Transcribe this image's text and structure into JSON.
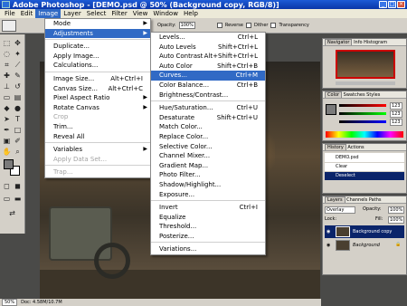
{
  "window": {
    "title": "Adobe Photoshop - [DEMO.psd @ 50% (Background copy, RGB/8)]",
    "controls": [
      "_",
      "□",
      "×"
    ]
  },
  "menubar": [
    "File",
    "Edit",
    "Image",
    "Layer",
    "Select",
    "Filter",
    "View",
    "Window",
    "Help"
  ],
  "options": {
    "opacity_label": "Opacity:",
    "opacity_value": "100%",
    "reverse": "Reverse",
    "dither": "Dither",
    "transparency": "Transparency"
  },
  "image_menu": [
    {
      "label": "Mode",
      "arrow": true
    },
    {
      "label": "Adjustments",
      "arrow": true,
      "selected": true
    },
    {
      "sep": true
    },
    {
      "label": "Duplicate..."
    },
    {
      "label": "Apply Image..."
    },
    {
      "label": "Calculations..."
    },
    {
      "sep": true
    },
    {
      "label": "Image Size...",
      "shortcut": "Alt+Ctrl+I"
    },
    {
      "label": "Canvas Size...",
      "shortcut": "Alt+Ctrl+C"
    },
    {
      "label": "Pixel Aspect Ratio",
      "arrow": true
    },
    {
      "label": "Rotate Canvas",
      "arrow": true
    },
    {
      "label": "Crop",
      "disabled": true
    },
    {
      "label": "Trim..."
    },
    {
      "label": "Reveal All"
    },
    {
      "sep": true
    },
    {
      "label": "Variables",
      "arrow": true
    },
    {
      "label": "Apply Data Set...",
      "disabled": true
    },
    {
      "sep": true
    },
    {
      "label": "Trap...",
      "disabled": true
    }
  ],
  "adjustments_menu": [
    {
      "label": "Levels...",
      "shortcut": "Ctrl+L"
    },
    {
      "label": "Auto Levels",
      "shortcut": "Shift+Ctrl+L"
    },
    {
      "label": "Auto Contrast",
      "shortcut": "Alt+Shift+Ctrl+L"
    },
    {
      "label": "Auto Color",
      "shortcut": "Shift+Ctrl+B"
    },
    {
      "label": "Curves...",
      "shortcut": "Ctrl+M",
      "selected": true
    },
    {
      "label": "Color Balance...",
      "shortcut": "Ctrl+B"
    },
    {
      "label": "Brightness/Contrast..."
    },
    {
      "sep": true
    },
    {
      "label": "Hue/Saturation...",
      "shortcut": "Ctrl+U"
    },
    {
      "label": "Desaturate",
      "shortcut": "Shift+Ctrl+U"
    },
    {
      "label": "Match Color..."
    },
    {
      "label": "Replace Color..."
    },
    {
      "label": "Selective Color..."
    },
    {
      "label": "Channel Mixer..."
    },
    {
      "label": "Gradient Map..."
    },
    {
      "label": "Photo Filter..."
    },
    {
      "label": "Shadow/Highlight..."
    },
    {
      "label": "Exposure..."
    },
    {
      "sep": true
    },
    {
      "label": "Invert",
      "shortcut": "Ctrl+I"
    },
    {
      "label": "Equalize"
    },
    {
      "label": "Threshold..."
    },
    {
      "label": "Posterize..."
    },
    {
      "sep": true
    },
    {
      "label": "Variations..."
    }
  ],
  "panels": {
    "navigator": {
      "tabs": [
        "Navigator",
        "Info",
        "Histogram"
      ]
    },
    "color": {
      "tabs": [
        "Color",
        "Swatches",
        "Styles"
      ],
      "values": [
        "123",
        "123",
        "123"
      ]
    },
    "history": {
      "tabs": [
        "History",
        "Actions"
      ],
      "items": [
        "DEMO.psd",
        "Clear",
        "Deselect"
      ]
    },
    "layers": {
      "tabs": [
        "Layers",
        "Channels",
        "Paths"
      ],
      "mode": "Overlay",
      "opacity_label": "Opacity:",
      "opacity_value": "100%",
      "lock_label": "Lock:",
      "fill_label": "Fill:",
      "fill_value": "100%",
      "items": [
        "Background copy",
        "Background"
      ]
    }
  },
  "status": {
    "zoom": "50%",
    "doc": "Doc: 4.58M/10.7M"
  }
}
